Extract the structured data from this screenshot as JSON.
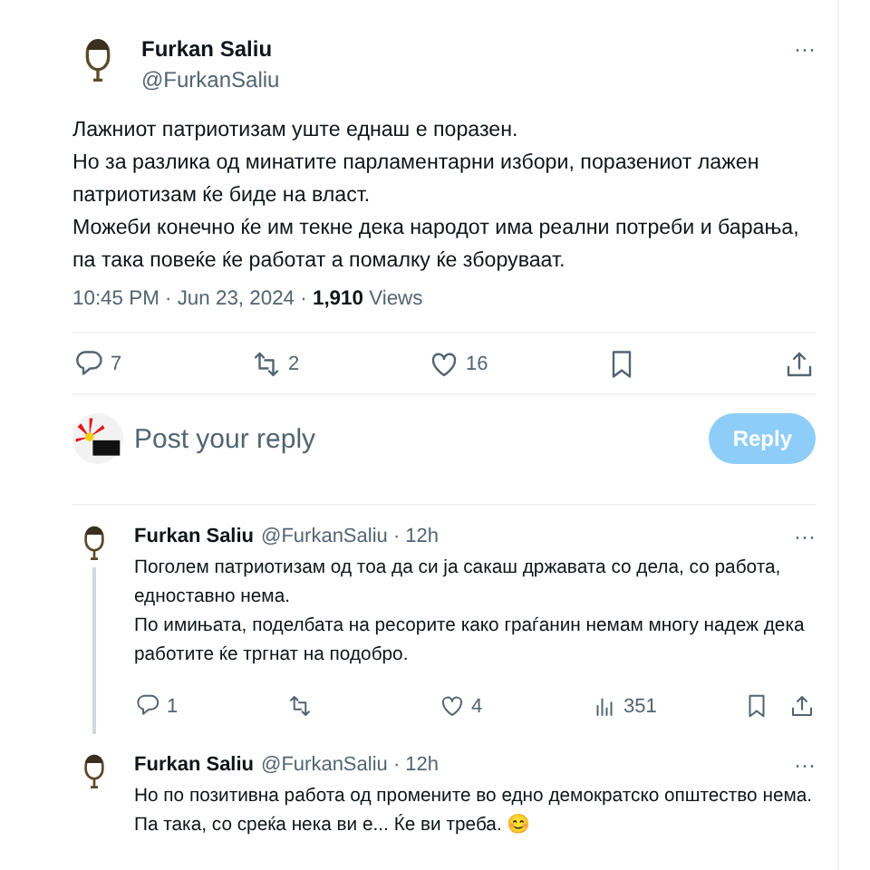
{
  "post": {
    "name": "Furkan Saliu",
    "handle": "@FurkanSaliu",
    "more": "···",
    "lines": [
      "Лажниот патриотизам уште еднаш е поразен.",
      "Но за разлика од минатите парламентарни избори, поразениот лажен патриотизам ќе биде на власт.",
      "Можеби конечно ќе им текне дека народот има реални потреби и барања, па така повеќе ќе работат а помалку ќе зборуваат."
    ],
    "time": "10:45 PM · Jun 23, 2024 · ",
    "views_count": "1,910",
    "views_label": "Views",
    "actions": [
      {
        "kind": "reply",
        "count": "7"
      },
      {
        "kind": "repost",
        "count": "2"
      },
      {
        "kind": "like",
        "count": "16",
        "selected": false
      },
      {
        "kind": "bookmark"
      },
      {
        "kind": "share"
      }
    ]
  },
  "composer": {
    "placeholder": "Post your reply",
    "button": "Reply",
    "disabled": true
  },
  "replies": [
    {
      "name": "Furkan Saliu",
      "handle": "@FurkanSaliu · 12h",
      "more": "···",
      "thread": true,
      "lines": [
        "Поголем патриотизам од тоа да си ја сакаш државата со дела, со работа, едноставно нема.",
        "По имињата, поделбата на ресорите како граѓанин немам многу надеж дека работите ќе тргнат на подобро."
      ],
      "actions": [
        {
          "kind": "reply",
          "count": "1"
        },
        {
          "kind": "repost"
        },
        {
          "kind": "like",
          "count": "4",
          "selected": false
        },
        {
          "kind": "views",
          "count": "351"
        },
        {
          "kind": "bookmark"
        },
        {
          "kind": "share"
        }
      ]
    },
    {
      "name": "Furkan Saliu",
      "handle": "@FurkanSaliu · 12h",
      "more": "···",
      "thread": false,
      "lines": [
        "Но по позитивна работа од промените во едно демократско општество нема.",
        "Па така, со среќа нека ви е... Ќе ви треба. 😊"
      ]
    }
  ]
}
